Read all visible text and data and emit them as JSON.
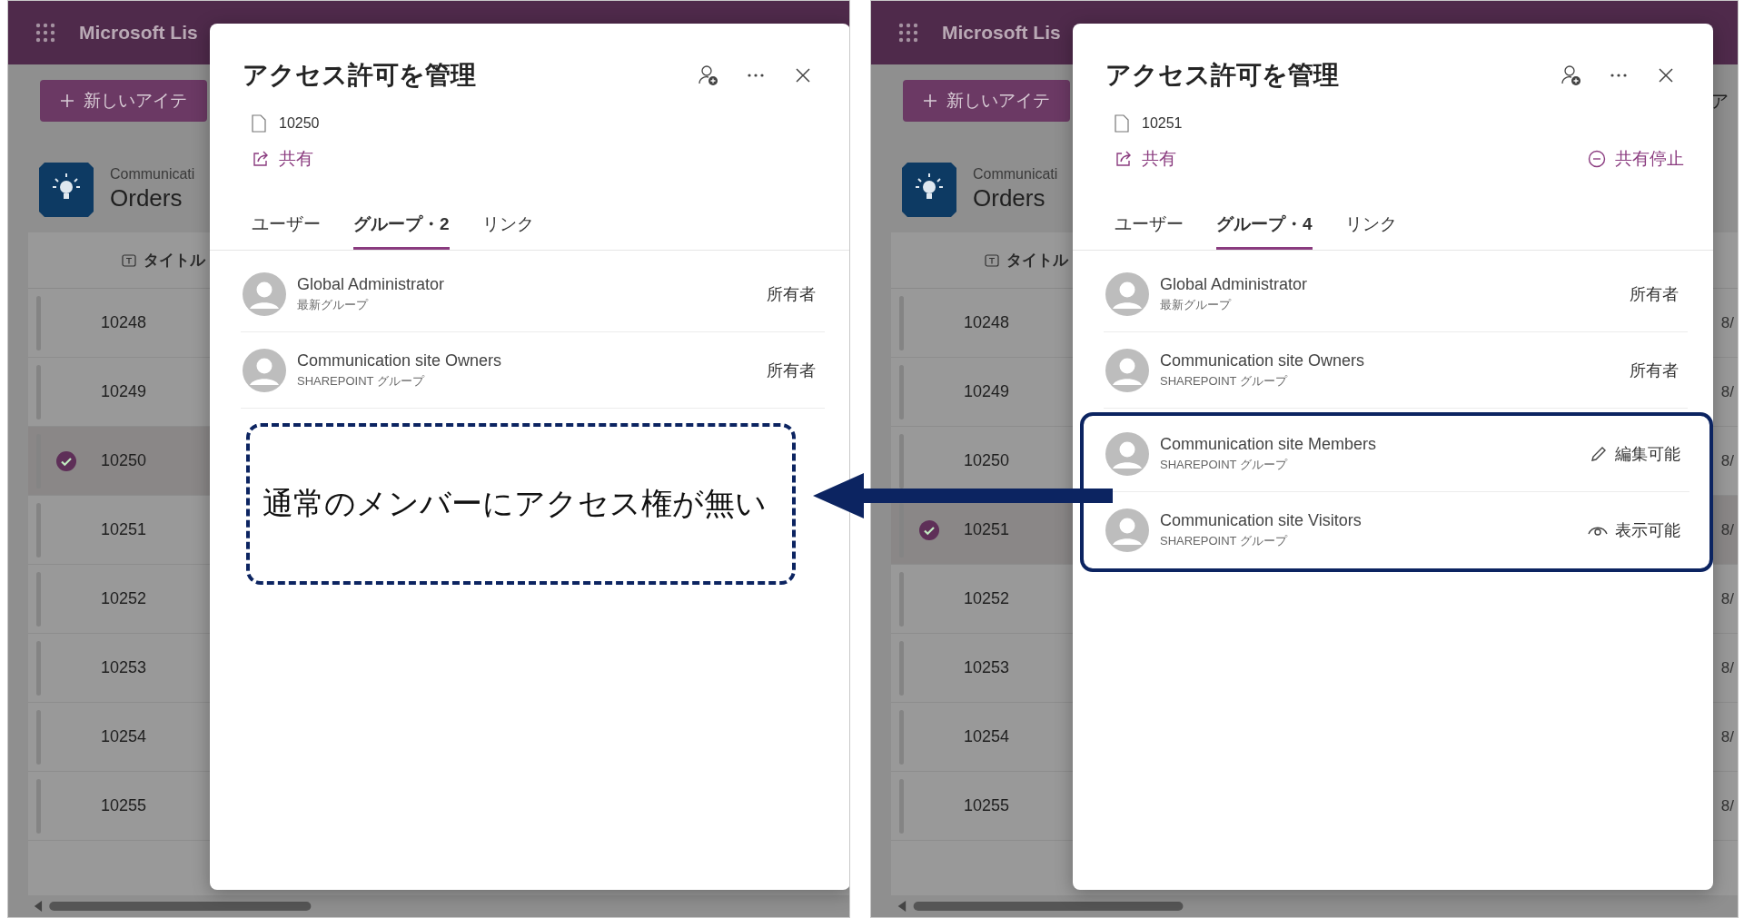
{
  "panels": [
    {
      "app": {
        "title": "Microsoft Lis",
        "new_item": "新しいアイテ",
        "site": "Communicati",
        "list_name": "Orders",
        "column": "タイトル",
        "rows": [
          {
            "title": "10248",
            "selected": false
          },
          {
            "title": "10249",
            "selected": false
          },
          {
            "title": "10250",
            "selected": true
          },
          {
            "title": "10251",
            "selected": false
          },
          {
            "title": "10252",
            "selected": false
          },
          {
            "title": "10253",
            "selected": false
          },
          {
            "title": "10254",
            "selected": false
          },
          {
            "title": "10255",
            "selected": false
          }
        ]
      },
      "dialog": {
        "title": "アクセス許可を管理",
        "item": "10250",
        "share": "共有",
        "tabs": [
          {
            "label": "ユーザー",
            "selected": false
          },
          {
            "label": "グループ・2",
            "selected": true
          },
          {
            "label": "リンク",
            "selected": false
          }
        ],
        "groups": [
          {
            "name": "Global Administrator",
            "subtitle": "最新グループ",
            "role": "所有者",
            "kind": "plain",
            "highlighted": false
          },
          {
            "name": "Communication site Owners",
            "subtitle": "SHAREPOINT グループ",
            "role": "所有者",
            "kind": "plain",
            "highlighted": false
          }
        ],
        "callout": "通常のメンバーにアクセス権が無い"
      }
    },
    {
      "app": {
        "title": "Microsoft Lis",
        "new_item": "新しいアイテ",
        "command_extra": "ア",
        "site": "Communicati",
        "list_name": "Orders",
        "column": "タイトル",
        "rows": [
          {
            "title": "10248",
            "selected": false,
            "column_2": "8/"
          },
          {
            "title": "10249",
            "selected": false,
            "column_2": "8/"
          },
          {
            "title": "10250",
            "selected": false,
            "column_2": "8/"
          },
          {
            "title": "10251",
            "selected": true,
            "column_2": "8/"
          },
          {
            "title": "10252",
            "selected": false,
            "column_2": "8/"
          },
          {
            "title": "10253",
            "selected": false,
            "column_2": "8/"
          },
          {
            "title": "10254",
            "selected": false,
            "column_2": "8/"
          },
          {
            "title": "10255",
            "selected": false,
            "column_2": "8/"
          }
        ]
      },
      "dialog": {
        "title": "アクセス許可を管理",
        "item": "10251",
        "share": "共有",
        "stop_share": "共有停止",
        "tabs": [
          {
            "label": "ユーザー",
            "selected": false
          },
          {
            "label": "グループ・4",
            "selected": true
          },
          {
            "label": "リンク",
            "selected": false
          }
        ],
        "groups": [
          {
            "name": "Global Administrator",
            "subtitle": "最新グループ",
            "role": "所有者",
            "kind": "plain",
            "highlighted": false
          },
          {
            "name": "Communication site Owners",
            "subtitle": "SHAREPOINT グループ",
            "role": "所有者",
            "kind": "plain",
            "highlighted": false
          },
          {
            "name": "Communication site Members",
            "subtitle": "SHAREPOINT グループ",
            "role": "編集可能",
            "kind": "edit",
            "highlighted": true
          },
          {
            "name": "Communication site Visitors",
            "subtitle": "SHAREPOINT グループ",
            "role": "表示可能",
            "kind": "view",
            "highlighted": true
          }
        ]
      }
    }
  ]
}
